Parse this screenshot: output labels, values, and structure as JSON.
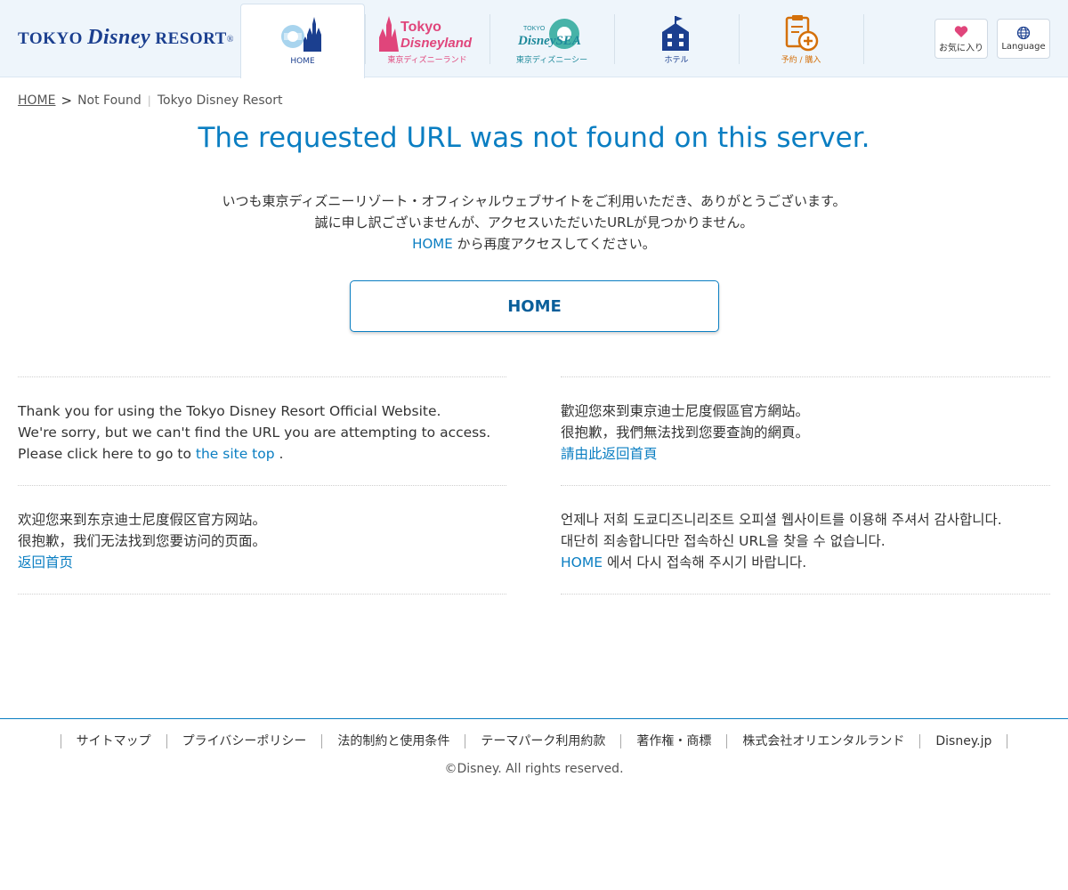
{
  "header": {
    "logo_text_1": "TOKYO ",
    "logo_text_2": "Disney",
    "logo_text_3": " RESORT",
    "logo_reg": "®",
    "tabs": [
      {
        "label": "HOME",
        "icon": "castle-icon",
        "color": "#1b3f8f"
      },
      {
        "label": "東京ディズニーランド",
        "icon": "tokyo-disneyland-logo",
        "logo_line1": "Tokyo",
        "logo_line2": "Disneyland",
        "color": "#e0457b"
      },
      {
        "label": "東京ディズニーシー",
        "icon": "tokyo-disneysea-logo",
        "logo_line0": "TOKYO",
        "logo_line1": "DisneySEA",
        "color": "#1f8a9b"
      },
      {
        "label": "ホテル",
        "icon": "hotel-icon",
        "color": "#1b3f8f"
      },
      {
        "label": "予約 / 購入",
        "icon": "reservation-icon",
        "color": "#d4700a"
      }
    ],
    "favorites_label": "お気に入り",
    "language_label": "Language"
  },
  "breadcrumb": {
    "home": "HOME",
    "separator": ">",
    "current": "Not Found",
    "site": "Tokyo Disney Resort"
  },
  "title": "The requested URL was not found on this server.",
  "message_ja": {
    "line1": "いつも東京ディズニーリゾート・オフィシャルウェブサイトをご利用いただき、ありがとうございます。",
    "line2": "誠に申し訳ございませんが、アクセスいただいたURLが見つかりません。",
    "link": "HOME",
    "line3_rest": " から再度アクセスしてください。"
  },
  "home_button": "HOME",
  "english": {
    "line1": "Thank you for using the Tokyo Disney Resort Official Website.",
    "line2": "We're sorry, but we can't find the URL you are attempting to access.",
    "line3_pre": "Please click here to go to ",
    "link": "the site top",
    "line3_post": " ."
  },
  "traditional_chinese": {
    "line1": "歡迎您來到東京迪士尼度假區官方網站。",
    "line2": "很抱歉，我們無法找到您要查詢的網頁。",
    "link": "請由此返回首頁"
  },
  "simplified_chinese": {
    "line1": "欢迎您来到东京迪士尼度假区官方网站。",
    "line2": "很抱歉，我们无法找到您要访问的页面。",
    "link": "返回首页"
  },
  "korean": {
    "line1": "언제나 저희 도쿄디즈니리조트 오피셜 웹사이트를 이용해 주셔서 감사합니다.",
    "line2": "대단히 죄송합니다만 접속하신 URL을 찾을 수 없습니다.",
    "link": "HOME",
    "line3_rest": " 에서 다시 접속해 주시기 바랍니다."
  },
  "footer": {
    "links": [
      "サイトマップ",
      "プライバシーポリシー",
      "法的制約と使用条件",
      "テーマパーク利用約款",
      "著作権・商標",
      "株式会社オリエンタルランド",
      "Disney.jp"
    ],
    "copyright": "©Disney. All rights reserved."
  },
  "colors": {
    "accent": "#0a7ec2",
    "header_bg": "#eef5fb",
    "favorite_heart": "#e0457b"
  }
}
